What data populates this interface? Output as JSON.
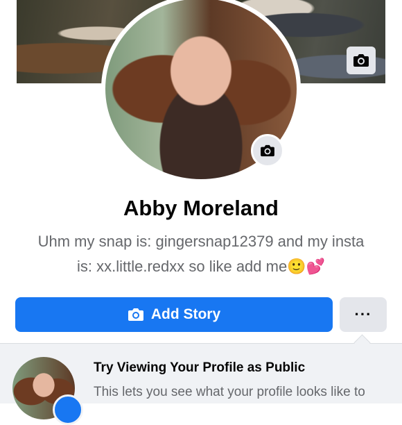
{
  "profile": {
    "name": "Abby Moreland",
    "bio_line1": "Uhm my snap is: gingersnap12379 and my insta",
    "bio_line2": "is: xx.little.redxx so like add me🙂💕"
  },
  "actions": {
    "add_story_label": "Add Story",
    "more_label": "···"
  },
  "tip": {
    "title": "Try Viewing Your Profile as Public",
    "text": "This lets you see what your profile looks like to"
  },
  "icons": {
    "cover_camera": "camera-icon",
    "avatar_camera": "camera-icon",
    "story_camera": "camera-icon"
  },
  "colors": {
    "primary": "#1877f2",
    "secondary_button": "#e4e6eb",
    "muted_text": "#65676b"
  }
}
